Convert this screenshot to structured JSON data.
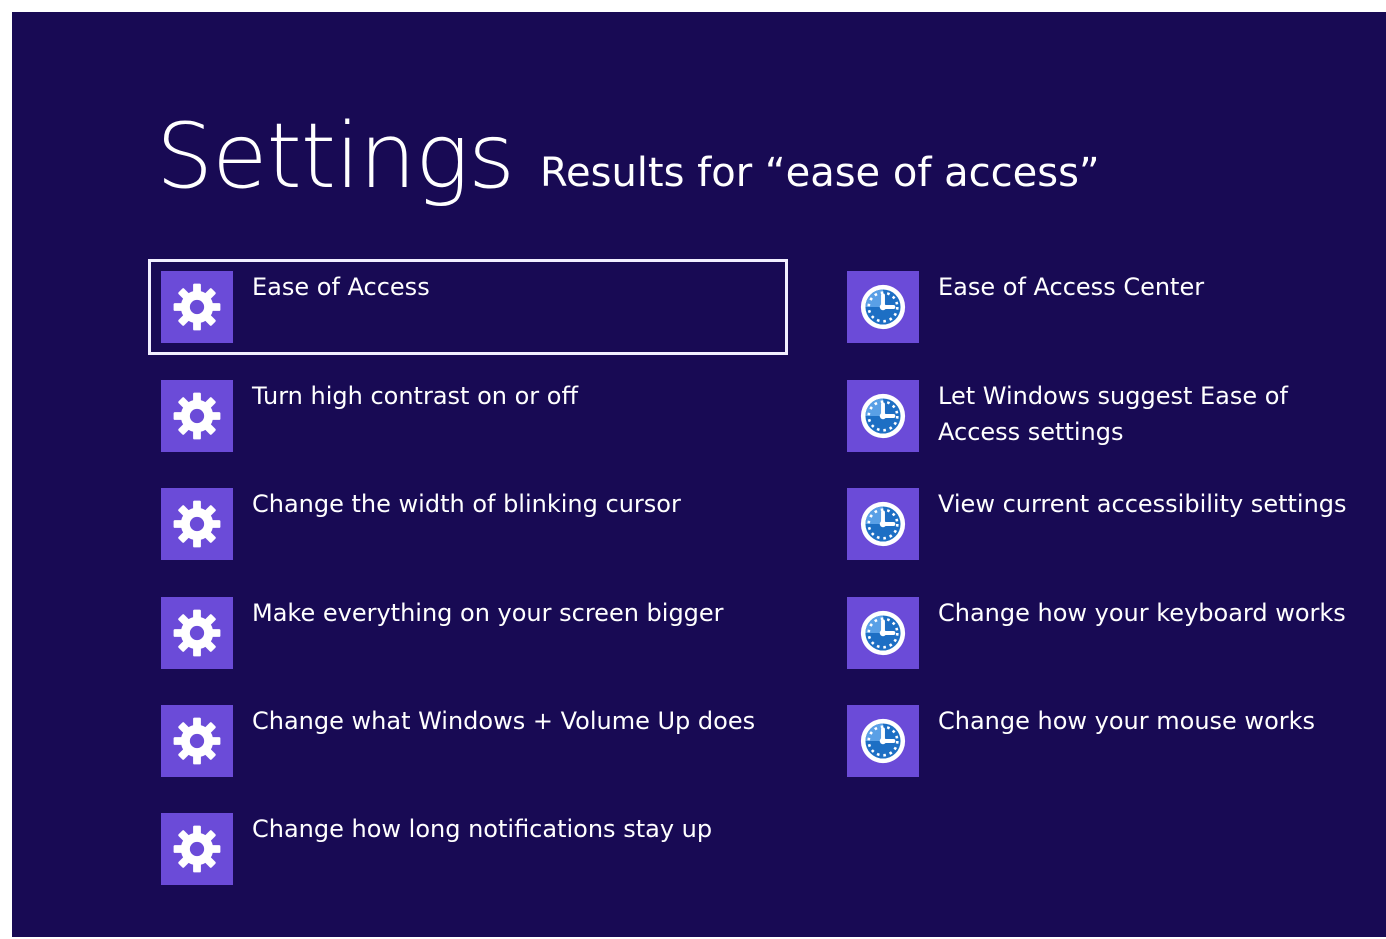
{
  "header": {
    "title": "Settings",
    "subtitle": "Results for “ease of access”"
  },
  "colors": {
    "background": "#180a54",
    "tile": "#6b4bd8",
    "selection_border": "#f1efff",
    "text": "#ffffff"
  },
  "results": {
    "left": [
      {
        "label": "Ease of Access",
        "icon": "gear-icon",
        "selected": true
      },
      {
        "label": "Turn high contrast on or off",
        "icon": "gear-icon"
      },
      {
        "label": "Change the width of blinking cursor",
        "icon": "gear-icon"
      },
      {
        "label": "Make everything on your screen bigger",
        "icon": "gear-icon"
      },
      {
        "label": "Change what Windows + Volume Up does",
        "icon": "gear-icon"
      },
      {
        "label": "Change how long notifications stay up",
        "icon": "gear-icon"
      }
    ],
    "right": [
      {
        "label": "Ease of Access Center",
        "icon": "ease-of-access-icon"
      },
      {
        "label": "Let Windows suggest Ease of Access settings",
        "icon": "ease-of-access-icon"
      },
      {
        "label": "View current accessibility settings",
        "icon": "ease-of-access-icon"
      },
      {
        "label": "Change how your keyboard works",
        "icon": "ease-of-access-icon"
      },
      {
        "label": "Change how your mouse works",
        "icon": "ease-of-access-icon"
      }
    ]
  }
}
